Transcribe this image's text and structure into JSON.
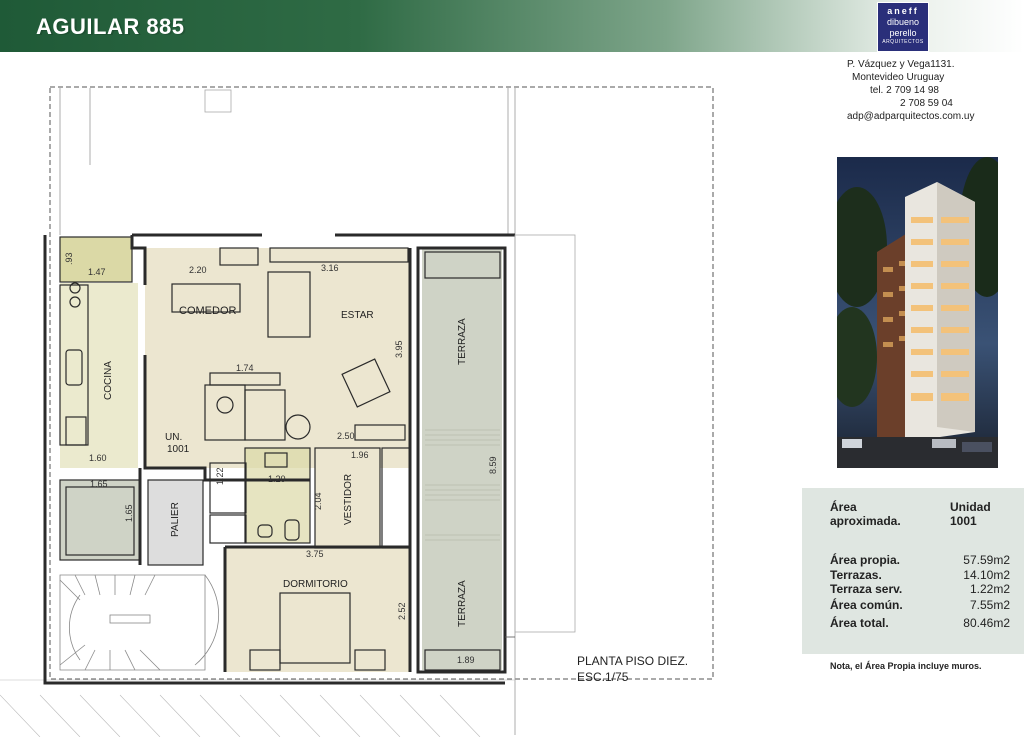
{
  "header": {
    "title": "AGUILAR 885"
  },
  "logo": {
    "line1": "aneff",
    "line2": "dibueno",
    "line3": "perello",
    "line4": "ARQUITECTOS"
  },
  "contact": {
    "address1": "P. Vázquez y Vega1131.",
    "address2": "Montevideo Uruguay",
    "tel1": "tel. 2 709 14 98",
    "tel2": "2 708 59 04",
    "email": "adp@adparquitectos.com.uy"
  },
  "areas": {
    "heading_label": "Área aproximada.",
    "heading_unit_label": "Unidad",
    "heading_unit_value": "1001",
    "rows": [
      {
        "label": "Área propia.",
        "value": "57.59m2"
      },
      {
        "label": "Terrazas.",
        "value": "14.10m2"
      },
      {
        "label": "Terraza serv.",
        "value": "1.22m2"
      },
      {
        "label": "Área común.",
        "value": "7.55m2"
      },
      {
        "label": "Área total.",
        "value": "80.46m2"
      }
    ],
    "note": "Nota, el Área Propia incluye muros."
  },
  "plan": {
    "label_line1": "PLANTA PISO DIEZ.",
    "label_line2": "ESC.1/75",
    "rooms": {
      "comedor": "COMEDOR",
      "estar": "ESTAR",
      "cocina": "COCINA",
      "unidad": "UN.",
      "unidad_num": "1001",
      "palier": "PALIER",
      "vestidor": "VESTIDOR",
      "dormitorio": "DORMITORIO",
      "terraza_top": "TERRAZA",
      "terraza_bottom": "TERRAZA"
    },
    "dims": {
      "d_93": ".93",
      "d_147": "1.47",
      "d_220": "2.20",
      "d_316": "3.16",
      "d_395": "3.95",
      "d_174": "1.74",
      "d_250": "2.50",
      "d_160": "1.60",
      "d_196": "1.96",
      "d_122": "1.22",
      "d_120": "1.20",
      "d_204": "2.04",
      "d_859": "8.59",
      "d_165a": "1.65",
      "d_165b": "1.65",
      "d_375": "3.75",
      "d_252": "2.52",
      "d_189": "1.89"
    },
    "colors": {
      "floor": "#ece6d0",
      "kitchen": "#dbd9a6",
      "wall": "#2a2a2a",
      "terrace": "#cfd3c6"
    }
  }
}
